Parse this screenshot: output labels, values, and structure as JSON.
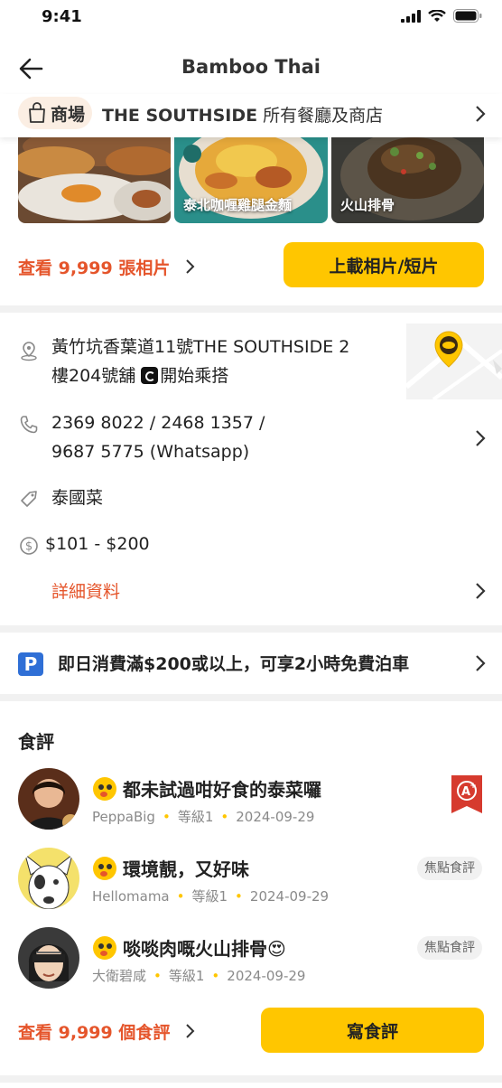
{
  "status_bar": {
    "time": "9:41"
  },
  "nav": {
    "title": "Bamboo Thai"
  },
  "mall": {
    "badge": "商場",
    "name": "THE SOUTHSIDE",
    "subtitle": "所有餐廳及商店"
  },
  "photos": {
    "items": [
      {
        "caption": ""
      },
      {
        "caption": "泰北咖喱雞腿金麵"
      },
      {
        "caption": "火山排骨"
      }
    ],
    "count_link": "查看 9,999 張相片",
    "upload_label": "上載相片/短片"
  },
  "info": {
    "address_line1": "黃竹坑香葉道11號THE SOUTHSIDE 2",
    "address_line2": "樓204號舖",
    "transit_label": "開始乘搭",
    "phone_line1": "2369 8022 / 2468 1357 /",
    "phone_line2": "9687 5775 (Whatsapp)",
    "cuisine": "泰國菜",
    "price_range": "$101 - $200",
    "details_link": "詳細資料"
  },
  "parking": {
    "text": "即日消費滿$200或以上，可享2小時免費泊車"
  },
  "reviews": {
    "heading": "食評",
    "items": [
      {
        "title": "都未試過咁好食的泰菜囉",
        "user": "PeppaBig",
        "level": "等級1",
        "date": "2024-09-29",
        "tag": ""
      },
      {
        "title": "環境靚，又好味",
        "user": "Hellomama",
        "level": "等級1",
        "date": "2024-09-29",
        "tag": "焦點食評"
      },
      {
        "title": "啖啖肉嘅火山排骨😍",
        "user": "大衛碧咸",
        "level": "等級1",
        "date": "2024-09-29",
        "tag": "焦點食評"
      }
    ],
    "count_link": "查看 9,999 個食評",
    "write_label": "寫食評"
  },
  "colors": {
    "accent": "#ffc600",
    "link": "#e5552b",
    "parking_blue": "#2f6fd6"
  }
}
